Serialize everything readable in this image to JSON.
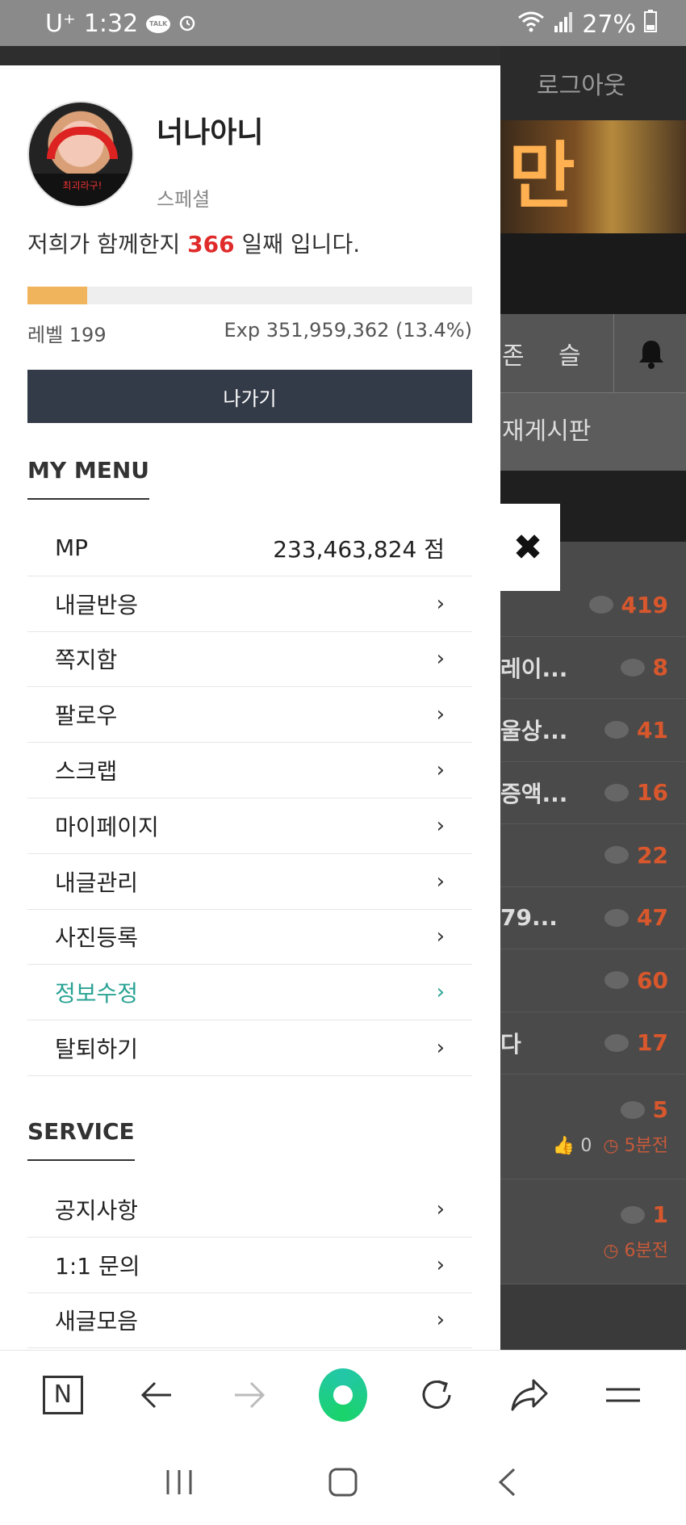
{
  "statusbar": {
    "carrier": "U⁺",
    "time": "1:32",
    "talk_badge": "TALK",
    "battery": "27%",
    "icons": [
      "talk-icon",
      "alarm-icon",
      "wifi-icon",
      "signal-icon",
      "battery-icon"
    ]
  },
  "background_page": {
    "logout": "로그아웃",
    "banner_text": "만",
    "nav_items": [
      "존",
      "슬"
    ],
    "board_title": "재게시판",
    "rows": [
      {
        "text": "",
        "count": "419"
      },
      {
        "text": "레이...",
        "count": "8"
      },
      {
        "text": "울상...",
        "count": "41"
      },
      {
        "text": "증액...",
        "count": "16"
      },
      {
        "text": "",
        "count": "22"
      },
      {
        "text": "79...",
        "count": "47"
      },
      {
        "text": "",
        "count": "60"
      },
      {
        "text": "다",
        "count": "17"
      }
    ],
    "meta_rows": [
      {
        "count": "5",
        "likes": "0",
        "time": "5분전"
      },
      {
        "count": "1",
        "likes": "",
        "time": "6분전"
      }
    ]
  },
  "profile": {
    "name": "너나아니",
    "grade": "스페셜",
    "together_prefix": "저희가 함께한지",
    "together_days": "366",
    "together_suffix": "일째 입니다.",
    "level_label": "레벨 199",
    "exp_label": "Exp 351,959,362 (13.4%)",
    "exp_fraction": 0.134,
    "exit_label": "나가기",
    "avatar_shirt_text": "최괴라구!"
  },
  "my_menu": {
    "title": "MY MENU",
    "mp_label": "MP",
    "mp_value": "233,463,824 점",
    "items": [
      {
        "label": "내글반응",
        "active": false
      },
      {
        "label": "쪽지함",
        "active": false
      },
      {
        "label": "팔로우",
        "active": false
      },
      {
        "label": "스크랩",
        "active": false
      },
      {
        "label": "마이페이지",
        "active": false
      },
      {
        "label": "내글관리",
        "active": false
      },
      {
        "label": "사진등록",
        "active": false
      },
      {
        "label": "정보수정",
        "active": true
      },
      {
        "label": "탈퇴하기",
        "active": false
      }
    ]
  },
  "service": {
    "title": "SERVICE",
    "items": [
      {
        "label": "공지사항"
      },
      {
        "label": "1:1 문의"
      },
      {
        "label": "새글모음"
      }
    ]
  },
  "chevron": "›",
  "close_symbol": "✖",
  "browser_toolbar": {
    "n_label": "N",
    "icons": [
      "naver-n-icon",
      "back-arrow-icon",
      "forward-arrow-icon",
      "green-dot-icon",
      "reload-icon",
      "share-icon",
      "menu-icon"
    ]
  },
  "colors": {
    "accent_green": "#2aa394",
    "days_red": "#e02b2b",
    "exit_button": "#343b48",
    "progress_fill": "#f0b55c"
  }
}
